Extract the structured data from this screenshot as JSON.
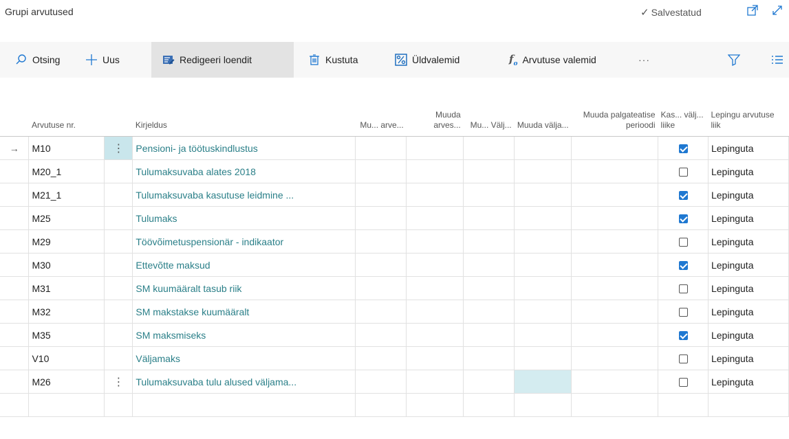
{
  "header": {
    "title": "Grupi arvutused",
    "saved_label": "Salvestatud"
  },
  "toolbar": {
    "search_label": "Otsing",
    "new_label": "Uus",
    "edit_list_label": "Redigeeri loendit",
    "delete_label": "Kustuta",
    "general_formulas_label": "Üldvalemid",
    "calc_formulas_label": "Arvutuse valemid",
    "more_label": "···"
  },
  "columns": {
    "c1": "Arvutuse nr.",
    "c2": "Kirjeldus",
    "c3": "Mu... arve...",
    "c4": "Muuda arves...",
    "c5": "Mu... Välj...",
    "c6": "Muuda välja...",
    "c7": "Muuda palgateatise perioodi",
    "c8": "Kas... välj... liike",
    "c9": "Lepingu arvutuse liik"
  },
  "rows": [
    {
      "nr": "M10",
      "desc": "Pensioni- ja töötuskindlustus",
      "checked": true,
      "type": "Lepinguta"
    },
    {
      "nr": "M20_1",
      "desc": "Tulumaksuvaba alates 2018",
      "checked": false,
      "type": "Lepinguta"
    },
    {
      "nr": "M21_1",
      "desc": "Tulumaksuvaba kasutuse leidmine ...",
      "checked": true,
      "type": "Lepinguta"
    },
    {
      "nr": "M25",
      "desc": "Tulumaks",
      "checked": true,
      "type": "Lepinguta"
    },
    {
      "nr": "M29",
      "desc": "Töövõimetuspensionär - indikaator",
      "checked": false,
      "type": "Lepinguta"
    },
    {
      "nr": "M30",
      "desc": "Ettevõtte maksud",
      "checked": true,
      "type": "Lepinguta"
    },
    {
      "nr": "M31",
      "desc": "SM kuumääralt tasub riik",
      "checked": false,
      "type": "Lepinguta"
    },
    {
      "nr": "M32",
      "desc": "SM makstakse kuumääralt",
      "checked": false,
      "type": "Lepinguta"
    },
    {
      "nr": "M35",
      "desc": "SM maksmiseks",
      "checked": true,
      "type": "Lepinguta"
    },
    {
      "nr": "V10",
      "desc": "Väljamaks",
      "checked": false,
      "type": "Lepinguta"
    },
    {
      "nr": "M26",
      "desc": "Tulumaksuvaba tulu alused väljama...",
      "checked": false,
      "type": "Lepinguta"
    }
  ]
}
